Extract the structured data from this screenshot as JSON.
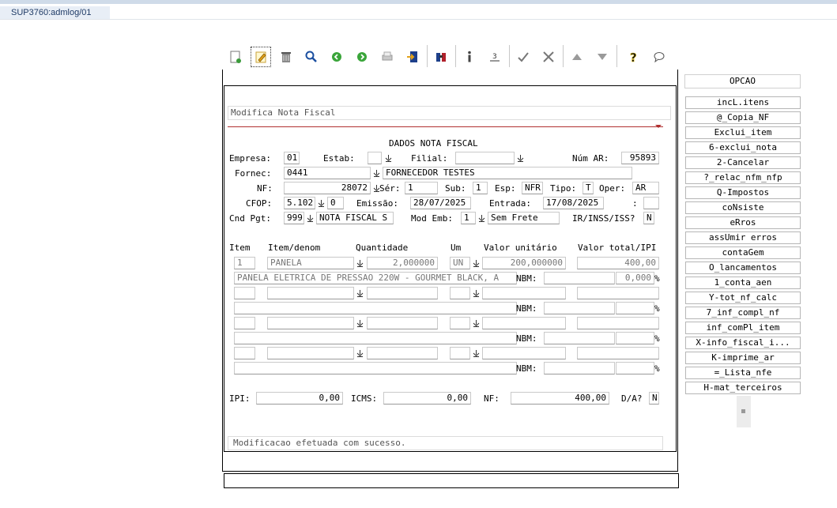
{
  "tab": {
    "label": "SUP3760:admlog/01"
  },
  "toolbar": {
    "icons": [
      "new-document-icon",
      "edit-pencil-icon",
      "trash-icon",
      "search-icon",
      "previous-green-icon",
      "next-green-icon",
      "print-icon",
      "export-icon",
      "binoculars-icon",
      "info-icon",
      "number-list-icon",
      "check-icon",
      "tools-icon",
      "arrow-up-icon",
      "arrow-down-icon",
      "help-icon",
      "chat-icon"
    ]
  },
  "form": {
    "title": "Modifica Nota Fiscal",
    "section": "DADOS NOTA FISCAL",
    "empresa_label": "Empresa:",
    "empresa": "01",
    "estab_label": "Estab:",
    "estab": "",
    "filial_label": "Filial:",
    "filial": "",
    "num_ar_label": "Núm AR:",
    "num_ar": "95893",
    "fornec_label": "Fornec:",
    "fornec": "0441",
    "fornec_nome": "FORNECEDOR TESTES",
    "nf_label": "NF:",
    "nf": "28072",
    "ser_label": "Sér:",
    "ser": "1",
    "sub_label": "Sub:",
    "sub": "1",
    "esp_label": "Esp:",
    "esp": "NFR",
    "tipo_label": "Tipo:",
    "tipo": "T",
    "oper_label": "Oper:",
    "oper": "AR",
    "cfop_label": "CFOP:",
    "cfop": "5.102",
    "cfop_seq": "0",
    "emissao_label": "Emissão:",
    "emissao": "28/07/2025",
    "entrada_label": "Entrada:",
    "entrada": "17/08/2025",
    "colon_label": ":",
    "colon_field": "",
    "cnd_pgt_label": "Cnd Pgt:",
    "cnd_pgt": "999",
    "cnd_pgt_desc": "NOTA FISCAL S",
    "mod_emb_label": "Mod Emb:",
    "mod_emb": "1",
    "mod_emb_desc": "Sem Frete",
    "ir_label": "IR/INSS/ISS?",
    "ir": "N"
  },
  "items": {
    "headers": [
      "Item",
      "Item/denom",
      "Quantidade",
      "Um",
      "Valor unitário",
      "Valor total/IPI"
    ],
    "row1": {
      "item": "1",
      "denom": "PANELA",
      "qtd": "2,000000",
      "um": "UN",
      "vlr_unit": "200,000000",
      "vlr_total": "400,00",
      "desc": "PANELA ELETRICA DE PRESSAO 220W - GOURMET BLACK, A",
      "ipi": "0,000"
    },
    "nbm_label": "NBM:",
    "pct": "%"
  },
  "totals": {
    "ipi_label": "IPI:",
    "ipi": "0,00",
    "icms_label": "ICMS:",
    "icms": "0,00",
    "nf_label": "NF:",
    "nf": "400,00",
    "da_label": "D/A?",
    "da": "N"
  },
  "status": "Modificacao efetuada com sucesso.",
  "sidebar": {
    "header": "OPCAO",
    "buttons": [
      "incL.itens",
      "@_Copia_NF",
      "Exclui_item",
      "6-exclui_nota",
      "2-Cancelar",
      "?_relac_nfm_nfp",
      "Q-Impostos",
      "coNsiste",
      "eRros",
      "assUmir erros",
      "contaGem",
      "O_lancamentos",
      "1_conta_aen",
      "Y-tot_nf_calc",
      "7_inf_compl_nf",
      "inf_comPl_item",
      "X-info_fiscal_i...",
      "K-imprime_ar",
      "=_Lista_nfe",
      "H-mat_terceiros"
    ]
  }
}
